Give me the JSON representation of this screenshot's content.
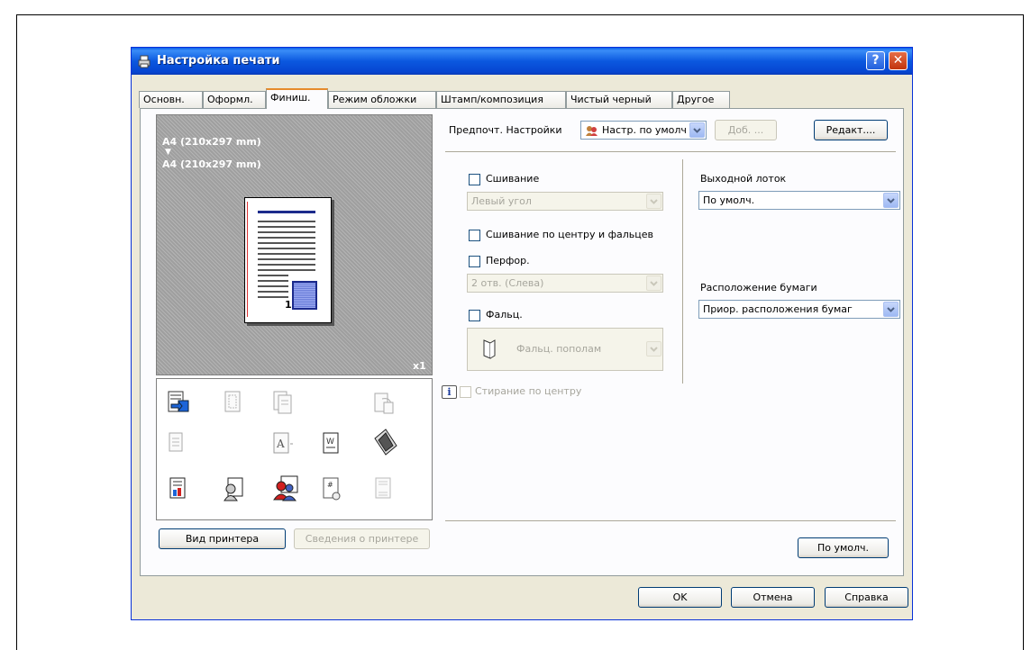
{
  "window": {
    "title": "Настройка печати"
  },
  "tabs": [
    "Основн.",
    "Оформл.",
    "Финиш.",
    "Режим обложки",
    "Штамп/композиция",
    "Чистый черный",
    "Другое"
  ],
  "preview": {
    "paper_source": "A4 (210x297 mm)",
    "arrow": "▼",
    "paper_output": "A4 (210x297 mm)",
    "page_number": "1",
    "copies": "x1"
  },
  "favorites": {
    "label": "Предпочт. Настройки",
    "value": "Настр. по умолч",
    "add_label": "Доб. ...",
    "edit_label": "Редакт...."
  },
  "staple": {
    "label": "Сшивание",
    "value": "Левый угол"
  },
  "center_staple": {
    "label": "Сшивание по центру и фальцев"
  },
  "punch": {
    "label": "Перфор.",
    "value": "2 отв. (Слева)"
  },
  "fold": {
    "label": "Фальц.",
    "value": "Фальц. пополам"
  },
  "center_erase": {
    "label": "Стирание по центру",
    "info_icon": "i"
  },
  "output_tray": {
    "label": "Выходной лоток",
    "value": "По умолч."
  },
  "paper_arrangement": {
    "label": "Расположение бумаги",
    "value": "Приор. расположения бумаг"
  },
  "buttons": {
    "printer_view": "Вид принтера",
    "printer_info": "Сведения о принтере",
    "default": "По умолч.",
    "ok": "OK",
    "cancel": "Отмена",
    "help": "Справка"
  }
}
